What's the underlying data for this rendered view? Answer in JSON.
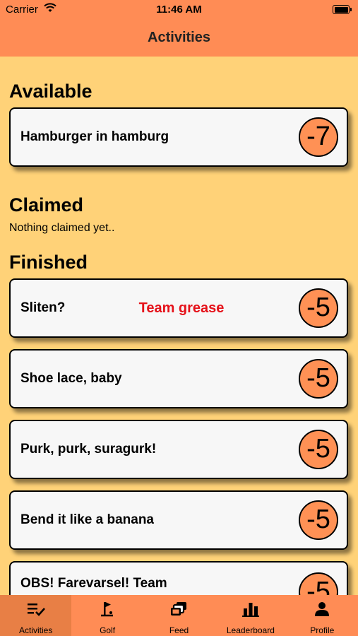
{
  "status": {
    "carrier": "Carrier",
    "time": "11:46 AM"
  },
  "nav": {
    "title": "Activities"
  },
  "sections": {
    "available": {
      "title": "Available",
      "items": [
        {
          "name": "Hamburger in hamburg",
          "score": "-7"
        }
      ]
    },
    "claimed": {
      "title": "Claimed",
      "empty": "Nothing claimed yet.."
    },
    "finished": {
      "title": "Finished",
      "items": [
        {
          "name": "Sliten?",
          "team": "Team grease",
          "score": "-5"
        },
        {
          "name": "Shoe lace, baby",
          "score": "-5"
        },
        {
          "name": "Purk, purk, suragurk!",
          "score": "-5"
        },
        {
          "name": "Bend it like a banana",
          "score": "-5"
        },
        {
          "name": "OBS! Farevarsel! Team",
          "score": "-5"
        }
      ]
    }
  },
  "tabs": [
    {
      "label": "Activities",
      "icon": "activities-icon",
      "active": true
    },
    {
      "label": "Golf",
      "icon": "golf-icon"
    },
    {
      "label": "Feed",
      "icon": "feed-icon"
    },
    {
      "label": "Leaderboard",
      "icon": "leaderboard-icon"
    },
    {
      "label": "Profile",
      "icon": "profile-icon"
    }
  ],
  "colors": {
    "background": "#FFD278",
    "bars": "#FF8C55",
    "active_tab": "#E87F45",
    "badge": "#FF9155",
    "team_text": "#E5121A"
  }
}
